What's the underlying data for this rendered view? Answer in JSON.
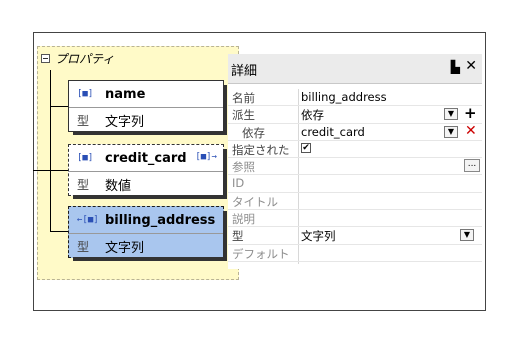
{
  "designer": {
    "group_label": "プロパティ",
    "cards": [
      {
        "name": "name",
        "type_label": "型",
        "type_value": "文字列",
        "icon": "[■]",
        "right_icon": ""
      },
      {
        "name": "credit_card",
        "type_label": "型",
        "type_value": "数値",
        "icon": "[■]",
        "right_icon": "[■]→"
      },
      {
        "name": "billing_address",
        "type_label": "型",
        "type_value": "文字列",
        "icon": "←[■]",
        "right_icon": ""
      }
    ]
  },
  "details": {
    "title": "詳細",
    "pin": "ᵖ",
    "close": "✕",
    "rows": [
      {
        "key": "名前",
        "value": "billing_address"
      },
      {
        "key": "派生",
        "value": "依存"
      },
      {
        "key": "依存",
        "value": "credit_card"
      },
      {
        "key": "指定された",
        "value": ""
      },
      {
        "key": "参照",
        "value": ""
      },
      {
        "key": "ID",
        "value": ""
      },
      {
        "key": "タイトル",
        "value": ""
      },
      {
        "key": "説明",
        "value": ""
      },
      {
        "key": "型",
        "value": "文字列"
      },
      {
        "key": "デフォルト",
        "value": ""
      }
    ],
    "checkbox_mark": "✔",
    "ellipsis": "...",
    "plus": "+",
    "remove": "✕",
    "dropdown_arrow": "▼"
  }
}
